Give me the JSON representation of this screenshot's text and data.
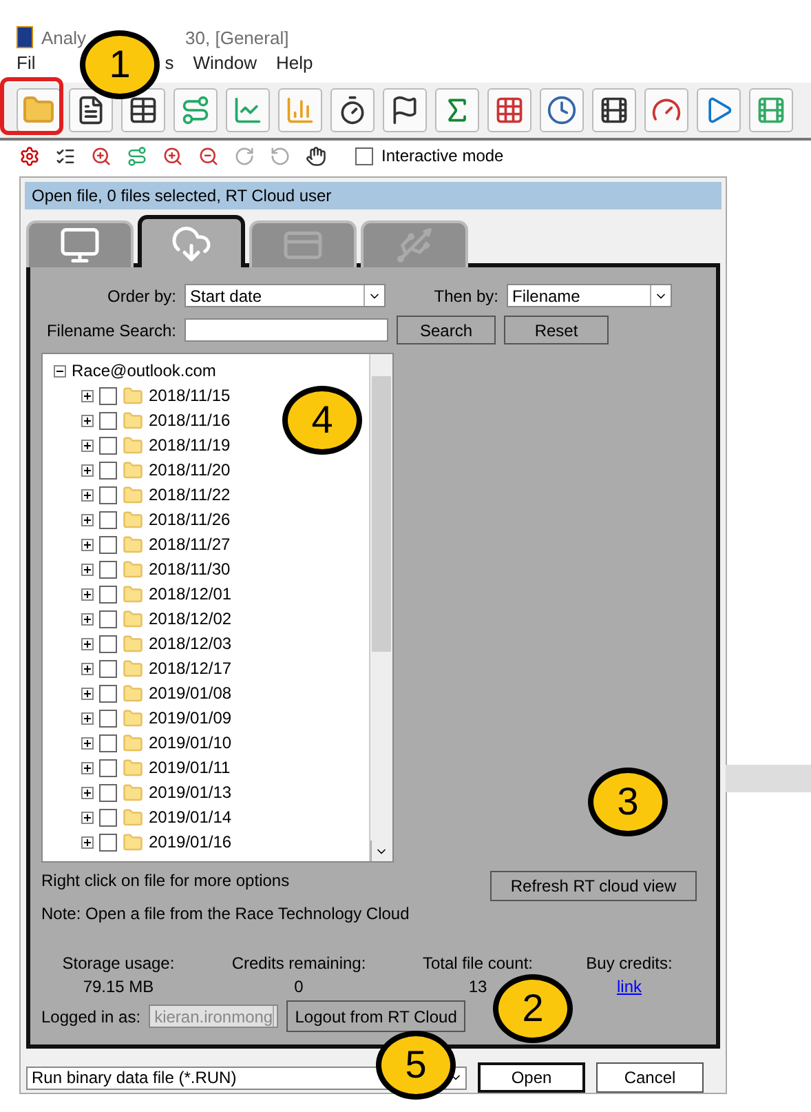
{
  "window": {
    "title_parts": [
      "Analy",
      "30, [General]"
    ]
  },
  "menu": [
    "Fil",
    "s",
    "Window",
    "Help"
  ],
  "toolbar": {
    "interactive_mode": {
      "label": "Interactive mode",
      "checked": false
    }
  },
  "dialog": {
    "header": "Open file, 0 files selected, RT Cloud user",
    "tabs": [
      {
        "kind": "computer",
        "selected": false,
        "disabled": false
      },
      {
        "kind": "cloud",
        "selected": true,
        "disabled": false
      },
      {
        "kind": "card",
        "selected": false,
        "disabled": true
      },
      {
        "kind": "usb",
        "selected": false,
        "disabled": true
      }
    ],
    "order_by": {
      "label": "Order by:",
      "value": "Start date"
    },
    "then_by": {
      "label": "Then by:",
      "value": "Filename"
    },
    "search": {
      "label": "Filename Search:"
    },
    "search_button": "Search",
    "reset_button": "Reset",
    "tree": {
      "root": "Race@outlook.com",
      "expanded": true,
      "children": [
        {
          "label": "2018/11/15",
          "checked": false,
          "expanded": false
        },
        {
          "label": "2018/11/16",
          "checked": false,
          "expanded": false
        },
        {
          "label": "2018/11/19",
          "checked": false,
          "expanded": false
        },
        {
          "label": "2018/11/20",
          "checked": false,
          "expanded": false
        },
        {
          "label": "2018/11/22",
          "checked": false,
          "expanded": false
        },
        {
          "label": "2018/11/26",
          "checked": false,
          "expanded": false
        },
        {
          "label": "2018/11/27",
          "checked": false,
          "expanded": false
        },
        {
          "label": "2018/11/30",
          "checked": false,
          "expanded": false
        },
        {
          "label": "2018/12/01",
          "checked": false,
          "expanded": false
        },
        {
          "label": "2018/12/02",
          "checked": false,
          "expanded": false
        },
        {
          "label": "2018/12/03",
          "checked": false,
          "expanded": false
        },
        {
          "label": "2018/12/17",
          "checked": false,
          "expanded": false
        },
        {
          "label": "2019/01/08",
          "checked": false,
          "expanded": false
        },
        {
          "label": "2019/01/09",
          "checked": false,
          "expanded": false
        },
        {
          "label": "2019/01/10",
          "checked": false,
          "expanded": false
        },
        {
          "label": "2019/01/11",
          "checked": false,
          "expanded": false
        },
        {
          "label": "2019/01/13",
          "checked": false,
          "expanded": false
        },
        {
          "label": "2019/01/14",
          "checked": false,
          "expanded": false
        },
        {
          "label": "2019/01/16",
          "checked": false,
          "expanded": false
        }
      ]
    },
    "hint": "Right click on file for more options",
    "refresh_button": "Refresh RT cloud view",
    "note": "Note: Open a file from the Race Technology Cloud",
    "stats": [
      {
        "label": "Storage usage:",
        "value": "79.15 MB",
        "kind": "text"
      },
      {
        "label": "Credits remaining:",
        "value": "0",
        "kind": "text"
      },
      {
        "label": "Total file count:",
        "value": "13",
        "kind": "text"
      },
      {
        "label": "Buy credits:",
        "value": "link",
        "kind": "link"
      }
    ],
    "logged_in": {
      "label": "Logged in as:",
      "value": "kieran.ironmong",
      "disabled": true
    },
    "logout_button": "Logout from RT Cloud",
    "file_type": "Run binary data file (*.RUN)",
    "open_button": "Open",
    "cancel_button": "Cancel"
  },
  "callouts": [
    {
      "text": "1",
      "kind": "c1"
    },
    {
      "text": "2",
      "kind": "c2"
    },
    {
      "text": "3",
      "kind": "c3"
    },
    {
      "text": "4",
      "kind": "c4"
    },
    {
      "text": "5",
      "kind": "c5"
    }
  ]
}
